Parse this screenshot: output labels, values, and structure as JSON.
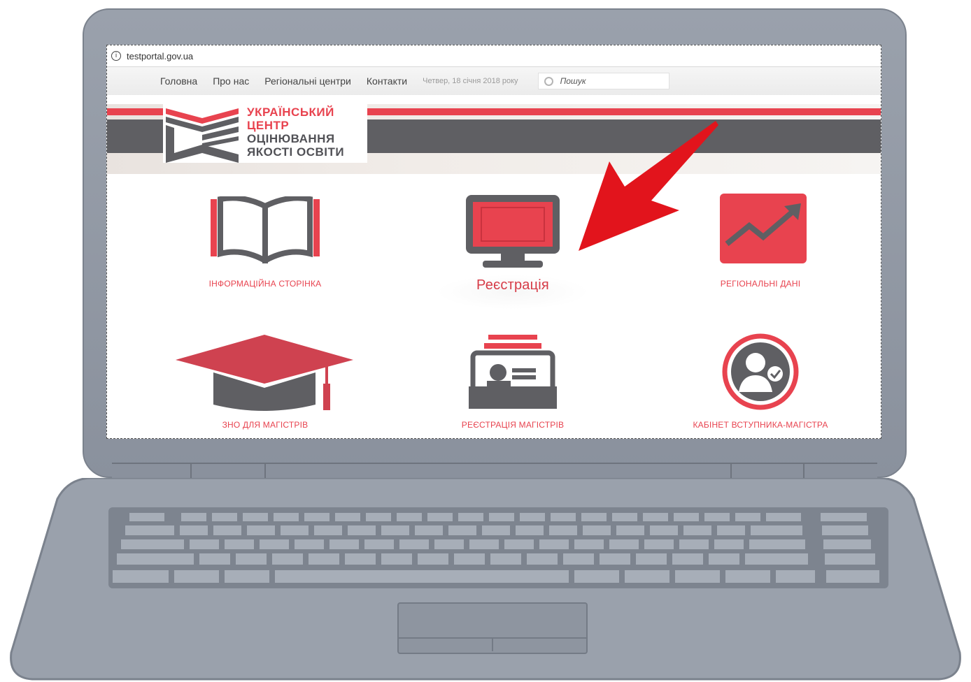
{
  "browser": {
    "url": "testportal.gov.ua"
  },
  "nav": {
    "items": [
      "Головна",
      "Про нас",
      "Регіональні центри",
      "Контакти"
    ],
    "date": "Четвер, 18 січня 2018 року",
    "search_placeholder": "Пошук"
  },
  "logo": {
    "lines": [
      "УКРАЇНСЬКИЙ",
      "ЦЕНТР",
      "ОЦІНЮВАННЯ",
      "ЯКОСТІ ОСВІТИ"
    ]
  },
  "tiles": [
    {
      "label": "ІНФОРМАЦІЙНА СТОРІНКА",
      "icon": "book-icon"
    },
    {
      "label": "Реєстрація",
      "icon": "monitor-icon"
    },
    {
      "label": "РЕГІОНАЛЬНІ ДАНІ",
      "icon": "chart-trend-icon"
    },
    {
      "label": "ЗНО ДЛЯ МАГІСТРІВ",
      "icon": "graduation-cap-icon"
    },
    {
      "label": "РЕЄСТРАЦІЯ МАГІСТРІВ",
      "icon": "id-card-stack-icon"
    },
    {
      "label": "КАБІНЕТ ВСТУПНИКА-МАГІСТРА",
      "icon": "user-check-icon"
    }
  ],
  "colors": {
    "accent": "#e8434f",
    "dark": "#5f5f63",
    "laptop": "#9aa1ac"
  }
}
